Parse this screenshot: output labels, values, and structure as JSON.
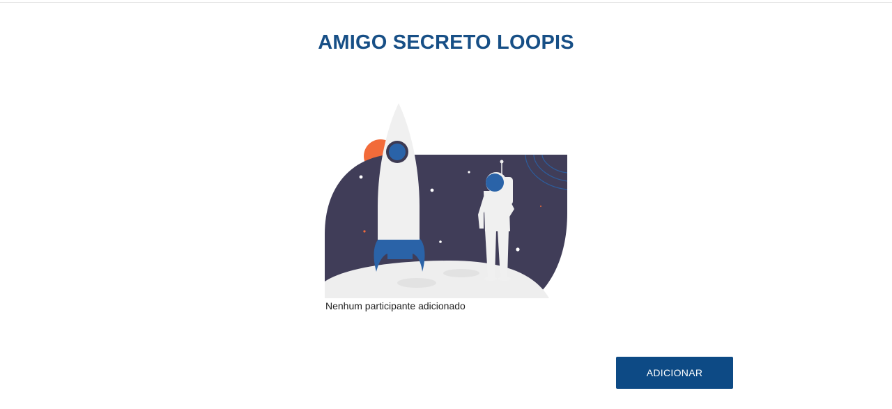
{
  "header": {
    "title": "AMIGO SECRETO LOOPIS"
  },
  "main": {
    "illustration": {
      "icon": "astronaut-rocket-moon-illustration"
    },
    "empty_message": "Nenhum participante adicionado",
    "add_button_label": "ADICIONAR"
  },
  "colors": {
    "title": "#174f86",
    "button_bg": "#0d4a85",
    "button_text": "#ffffff",
    "space": "#403d58",
    "sun": "#f26b3a",
    "accent_blue": "#2a63a8",
    "moon_surface": "#eeeeee",
    "rocket_body": "#f0f0f0"
  }
}
